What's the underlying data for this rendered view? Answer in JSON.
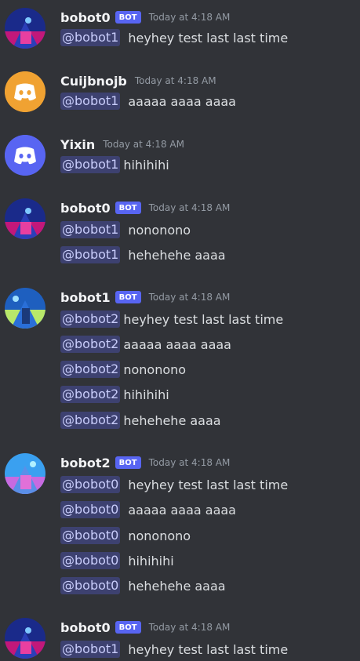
{
  "messages": [
    {
      "username": "bobot0",
      "bot": true,
      "bot_label": "BOT",
      "timestamp": "Today at 4:18 AM",
      "lines": [
        {
          "mention": "@bobot1",
          "text": "heyhey test last last time"
        }
      ]
    },
    {
      "username": "Cuijbnojb",
      "bot": false,
      "timestamp": "Today at 4:18 AM",
      "lines": [
        {
          "mention": "@bobot1",
          "text": "aaaaa aaaa aaaa"
        }
      ]
    },
    {
      "username": "Yixin",
      "bot": false,
      "timestamp": "Today at 4:18 AM",
      "lines": [
        {
          "mention": "@bobot1",
          "text": "hihihihi"
        }
      ]
    },
    {
      "username": "bobot0",
      "bot": true,
      "bot_label": "BOT",
      "timestamp": "Today at 4:18 AM",
      "lines": [
        {
          "mention": "@bobot1",
          "text": "nononono"
        },
        {
          "mention": "@bobot1",
          "text": "hehehehe aaaa"
        }
      ]
    },
    {
      "username": "bobot1",
      "bot": true,
      "bot_label": "BOT",
      "timestamp": "Today at 4:18 AM",
      "lines": [
        {
          "mention": "@bobot2",
          "text": "heyhey test last last time"
        },
        {
          "mention": "@bobot2",
          "text": "aaaaa aaaa aaaa"
        },
        {
          "mention": "@bobot2",
          "text": "nononono"
        },
        {
          "mention": "@bobot2",
          "text": "hihihihi"
        },
        {
          "mention": "@bobot2",
          "text": "hehehehe aaaa"
        }
      ]
    },
    {
      "username": "bobot2",
      "bot": true,
      "bot_label": "BOT",
      "timestamp": "Today at 4:18 AM",
      "lines": [
        {
          "mention": "@bobot0",
          "text": "heyhey test last last time"
        },
        {
          "mention": "@bobot0",
          "text": "aaaaa aaaa aaaa"
        },
        {
          "mention": "@bobot0",
          "text": "nononono"
        },
        {
          "mention": "@bobot0",
          "text": "hihihihi"
        },
        {
          "mention": "@bobot0",
          "text": "hehehehe aaaa"
        }
      ]
    },
    {
      "username": "bobot0",
      "bot": true,
      "bot_label": "BOT",
      "timestamp": "Today at 4:18 AM",
      "lines": [
        {
          "mention": "@bobot1",
          "text": "heyhey test last last time"
        }
      ]
    }
  ],
  "avatars": {
    "discord_orange": "#f0a232",
    "discord_blue": "#5865f2"
  }
}
